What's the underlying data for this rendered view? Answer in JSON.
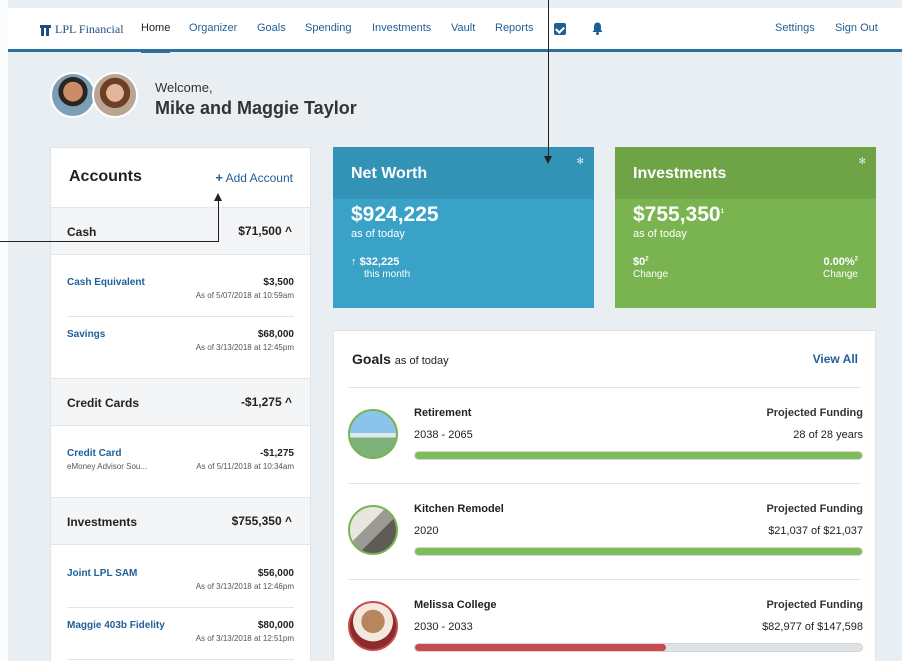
{
  "nav": {
    "brand": "LPL Financial",
    "items": [
      "Home",
      "Organizer",
      "Goals",
      "Spending",
      "Investments",
      "Vault",
      "Reports"
    ],
    "settings": "Settings",
    "signout": "Sign Out"
  },
  "welcome": {
    "greeting": "Welcome,",
    "name": "Mike and Maggie Taylor"
  },
  "accounts": {
    "title": "Accounts",
    "add_label": "Add Account",
    "cash": {
      "title": "Cash",
      "total": "$71,500"
    },
    "cash_rows": [
      {
        "name": "Cash Equivalent",
        "amount": "$3,500",
        "date": "As of 5/07/2018 at 10:59am"
      },
      {
        "name": "Savings",
        "amount": "$68,000",
        "date": "As of 3/13/2018 at 12:45pm"
      }
    ],
    "credit": {
      "title": "Credit Cards",
      "total": "-$1,275"
    },
    "credit_rows": [
      {
        "name": "Credit Card",
        "source": "eMoney Advisor Sou...",
        "amount": "-$1,275",
        "date": "As of 5/11/2018 at 10:34am"
      }
    ],
    "investments": {
      "title": "Investments",
      "total": "$755,350"
    },
    "investment_rows": [
      {
        "name": "Joint LPL SAM",
        "amount": "$56,000",
        "date": "As of 3/13/2018 at 12:46pm"
      },
      {
        "name": "Maggie 403b Fidelity",
        "amount": "$80,000",
        "date": "As of 3/13/2018 at 12:51pm"
      }
    ]
  },
  "networth": {
    "title": "Net Worth",
    "value": "$924,225",
    "as_of": "as of today",
    "change": "$32,225",
    "change_label": "this month"
  },
  "investments_tile": {
    "title": "Investments",
    "value": "$755,350",
    "as_of": "as of today",
    "left_value": "$0",
    "left_label": "Change",
    "right_value": "0.00%",
    "right_label": "Change"
  },
  "goals": {
    "title": "Goals",
    "subtitle": "as of today",
    "view_all": "View All",
    "items": [
      {
        "name": "Retirement",
        "years": "2038 - 2065",
        "label": "Projected Funding",
        "progress_text": "28 of 28 years",
        "pct": 1.0,
        "color": "#7cbd5a"
      },
      {
        "name": "Kitchen Remodel",
        "years": "2020",
        "label": "Projected Funding",
        "progress_text": "$21,037 of $21,037",
        "pct": 1.0,
        "color": "#7cbd5a"
      },
      {
        "name": "Melissa College",
        "years": "2030 - 2033",
        "label": "Projected Funding",
        "progress_text": "$82,977 of $147,598",
        "pct": 0.562,
        "color": "#c94c4c"
      }
    ]
  },
  "colors": {
    "accent": "#1f5f97",
    "networth": "#3aa2c6",
    "investments": "#79b451"
  }
}
